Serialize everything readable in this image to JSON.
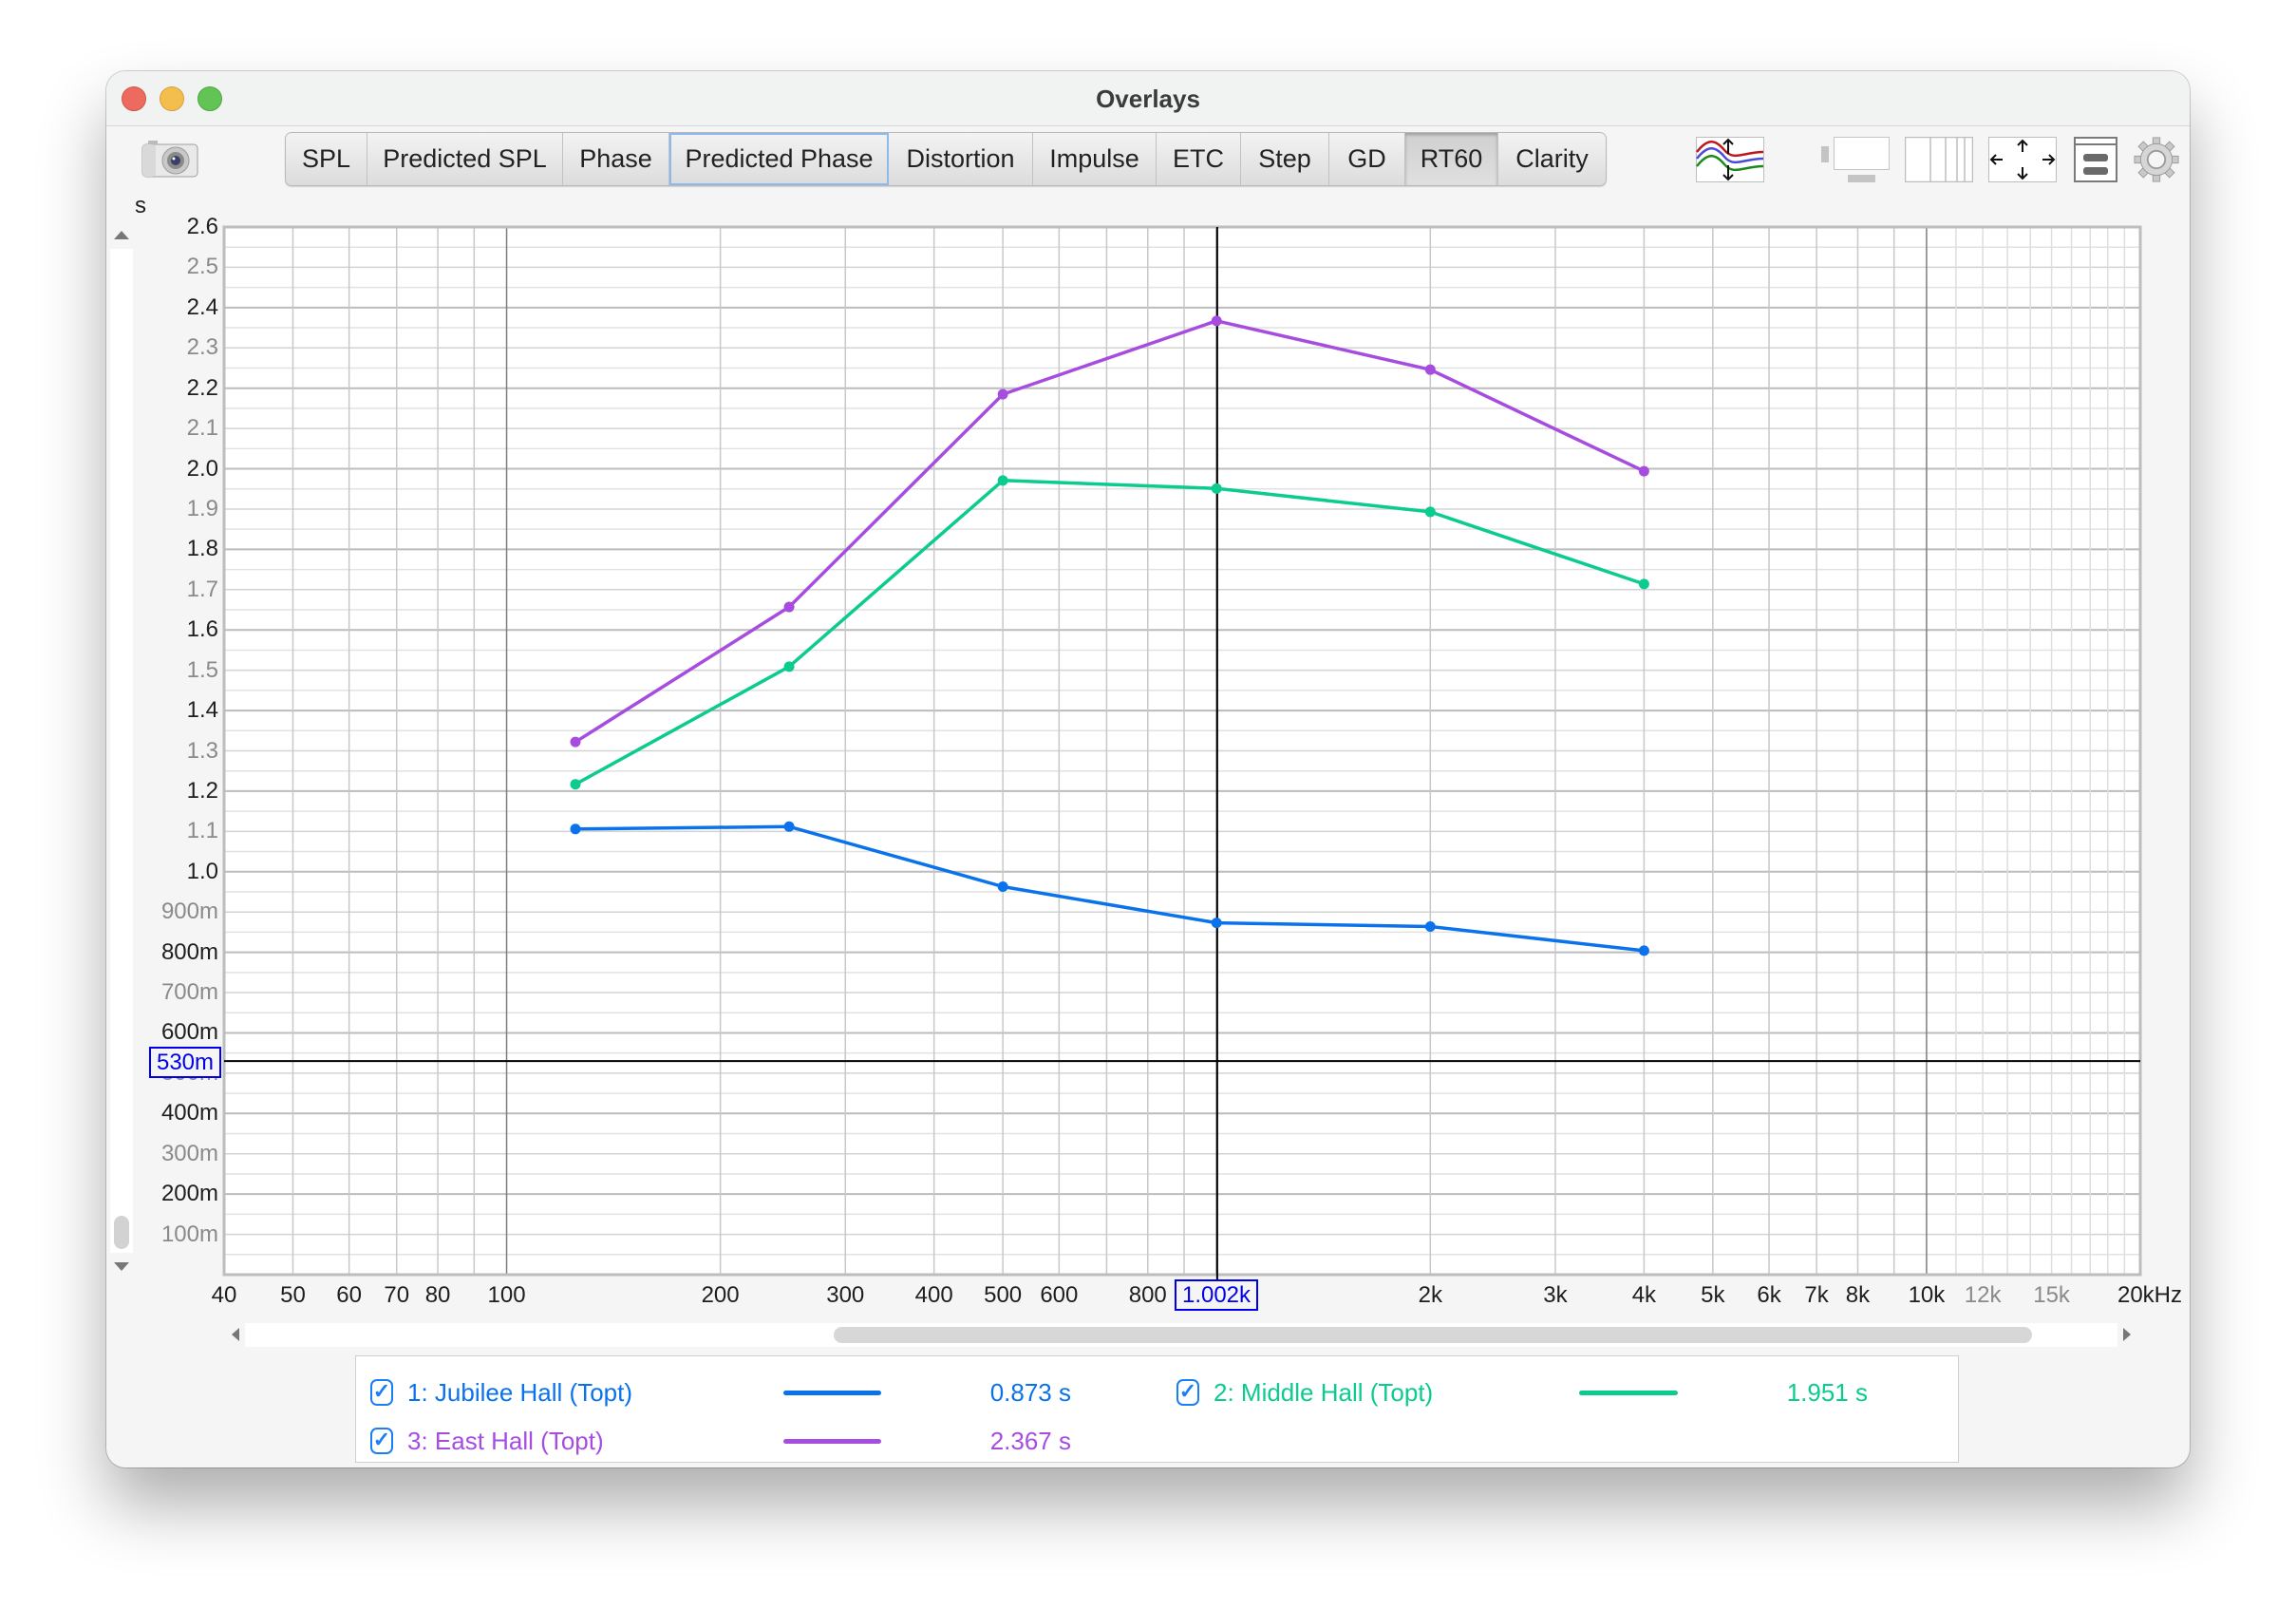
{
  "window": {
    "title": "Overlays",
    "traffic_lights": [
      "close",
      "minimize",
      "zoom"
    ]
  },
  "toolbar": {
    "camera_icon": "camera-icon",
    "tabs": [
      {
        "label": "SPL",
        "state": "normal"
      },
      {
        "label": "Predicted SPL",
        "state": "normal"
      },
      {
        "label": "Phase",
        "state": "normal"
      },
      {
        "label": "Predicted Phase",
        "state": "focused"
      },
      {
        "label": "Distortion",
        "state": "normal"
      },
      {
        "label": "Impulse",
        "state": "normal"
      },
      {
        "label": "ETC",
        "state": "normal"
      },
      {
        "label": "Step",
        "state": "normal"
      },
      {
        "label": "GD",
        "state": "normal"
      },
      {
        "label": "RT60",
        "state": "active"
      },
      {
        "label": "Clarity",
        "state": "normal"
      }
    ],
    "right_icons": [
      "trace-offset-icon",
      "display-size-icon",
      "columns-icon",
      "pan-arrows-icon",
      "controls-panel-icon",
      "gear-icon"
    ]
  },
  "cursor": {
    "x_label": "1.002k",
    "y_label": "530m"
  },
  "legend": [
    {
      "checked": true,
      "label": "1: Jubilee Hall (Topt)",
      "value": "0.873 s",
      "color": "#0a72ea"
    },
    {
      "checked": true,
      "label": "2: Middle Hall (Topt)",
      "value": "1.951  s",
      "color": "#0ccb8f"
    },
    {
      "checked": true,
      "label": "3: East Hall (Topt)",
      "value": "2.367  s",
      "color": "#a64de0"
    }
  ],
  "chart_data": {
    "type": "line",
    "title": "RT60",
    "xlabel": "Hz",
    "ylabel": "s",
    "xscale": "log",
    "xlim": [
      40,
      20000
    ],
    "ylim": [
      0,
      2.6
    ],
    "grid": true,
    "legend_position": "bottom",
    "x": [
      125,
      250,
      500,
      1000,
      2000,
      4000
    ],
    "series": [
      {
        "name": "1: Jubilee Hall (Topt)",
        "color": "#0a72ea",
        "values": [
          1.106,
          1.112,
          0.963,
          0.873,
          0.864,
          0.804
        ]
      },
      {
        "name": "2: Middle Hall (Topt)",
        "color": "#0ccb8f",
        "values": [
          1.217,
          1.509,
          1.971,
          1.951,
          1.893,
          1.714
        ]
      },
      {
        "name": "3: East Hall (Topt)",
        "color": "#a64de0",
        "values": [
          1.322,
          1.657,
          2.185,
          2.367,
          2.246,
          1.994
        ]
      }
    ],
    "y_unit_label": "s",
    "y_ticks": [
      {
        "value": 2.6,
        "label": "2.6",
        "major": true
      },
      {
        "value": 2.5,
        "label": "2.5",
        "major": false
      },
      {
        "value": 2.4,
        "label": "2.4",
        "major": true
      },
      {
        "value": 2.3,
        "label": "2.3",
        "major": false
      },
      {
        "value": 2.2,
        "label": "2.2",
        "major": true
      },
      {
        "value": 2.1,
        "label": "2.1",
        "major": false
      },
      {
        "value": 2.0,
        "label": "2.0",
        "major": true
      },
      {
        "value": 1.9,
        "label": "1.9",
        "major": false
      },
      {
        "value": 1.8,
        "label": "1.8",
        "major": true
      },
      {
        "value": 1.7,
        "label": "1.7",
        "major": false
      },
      {
        "value": 1.6,
        "label": "1.6",
        "major": true
      },
      {
        "value": 1.5,
        "label": "1.5",
        "major": false
      },
      {
        "value": 1.4,
        "label": "1.4",
        "major": true
      },
      {
        "value": 1.3,
        "label": "1.3",
        "major": false
      },
      {
        "value": 1.2,
        "label": "1.2",
        "major": true
      },
      {
        "value": 1.1,
        "label": "1.1",
        "major": false
      },
      {
        "value": 1.0,
        "label": "1.0",
        "major": true
      },
      {
        "value": 0.9,
        "label": "900m",
        "major": false
      },
      {
        "value": 0.8,
        "label": "800m",
        "major": true
      },
      {
        "value": 0.7,
        "label": "700m",
        "major": false
      },
      {
        "value": 0.6,
        "label": "600m",
        "major": true
      },
      {
        "value": 0.5,
        "label": "500m",
        "major": false
      },
      {
        "value": 0.4,
        "label": "400m",
        "major": true
      },
      {
        "value": 0.3,
        "label": "300m",
        "major": false
      },
      {
        "value": 0.2,
        "label": "200m",
        "major": true
      },
      {
        "value": 0.1,
        "label": "100m",
        "major": false
      }
    ],
    "x_ticks": [
      {
        "value": 40,
        "label": "40",
        "major": true
      },
      {
        "value": 50,
        "label": "50",
        "major": true
      },
      {
        "value": 60,
        "label": "60",
        "major": true
      },
      {
        "value": 70,
        "label": "70",
        "major": true
      },
      {
        "value": 80,
        "label": "80",
        "major": true
      },
      {
        "value": 100,
        "label": "100",
        "major": true
      },
      {
        "value": 200,
        "label": "200",
        "major": true
      },
      {
        "value": 300,
        "label": "300",
        "major": true
      },
      {
        "value": 400,
        "label": "400",
        "major": true
      },
      {
        "value": 500,
        "label": "500",
        "major": true
      },
      {
        "value": 600,
        "label": "600",
        "major": true
      },
      {
        "value": 800,
        "label": "800",
        "major": true
      },
      {
        "value": 2000,
        "label": "2k",
        "major": true
      },
      {
        "value": 3000,
        "label": "3k",
        "major": true
      },
      {
        "value": 4000,
        "label": "4k",
        "major": true
      },
      {
        "value": 5000,
        "label": "5k",
        "major": true
      },
      {
        "value": 6000,
        "label": "6k",
        "major": true
      },
      {
        "value": 7000,
        "label": "7k",
        "major": true
      },
      {
        "value": 8000,
        "label": "8k",
        "major": true
      },
      {
        "value": 10000,
        "label": "10k",
        "major": true
      },
      {
        "value": 12000,
        "label": "12k",
        "major": false
      },
      {
        "value": 15000,
        "label": "15k",
        "major": false
      },
      {
        "value": 20000,
        "label": "20kHz",
        "major": true
      }
    ],
    "cursor": {
      "x": 1002,
      "y": 0.53
    }
  }
}
